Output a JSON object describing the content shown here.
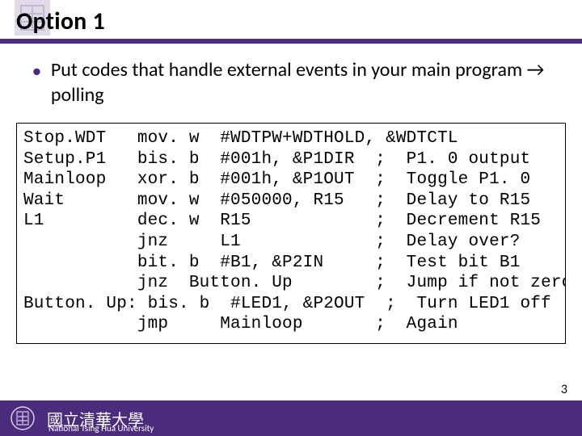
{
  "title": "Option 1",
  "bullet": "Put codes that handle external events in your main program → polling",
  "code_lines": [
    "Stop.WDT   mov. w  #WDTPW+WDTHOLD, &WDTCTL",
    "Setup.P1   bis. b  #001h, &P1DIR  ;  P1. 0 output",
    "Mainloop   xor. b  #001h, &P1OUT  ;  Toggle P1. 0",
    "Wait       mov. w  #050000, R15   ;  Delay to R15",
    "L1         dec. w  R15            ;  Decrement R15",
    "           jnz     L1             ;  Delay over?",
    "           bit. b  #B1, &P2IN     ;  Test bit B1",
    "           jnz  Button. Up        ;  Jump if not zero",
    "Button. Up: bis. b  #LED1, &P2OUT  ;  Turn LED1 off",
    "           jmp     Mainloop       ;  Again"
  ],
  "footer": {
    "chinese": "國立清華大學",
    "english": "National Tsing Hua University"
  },
  "page_number": "3"
}
